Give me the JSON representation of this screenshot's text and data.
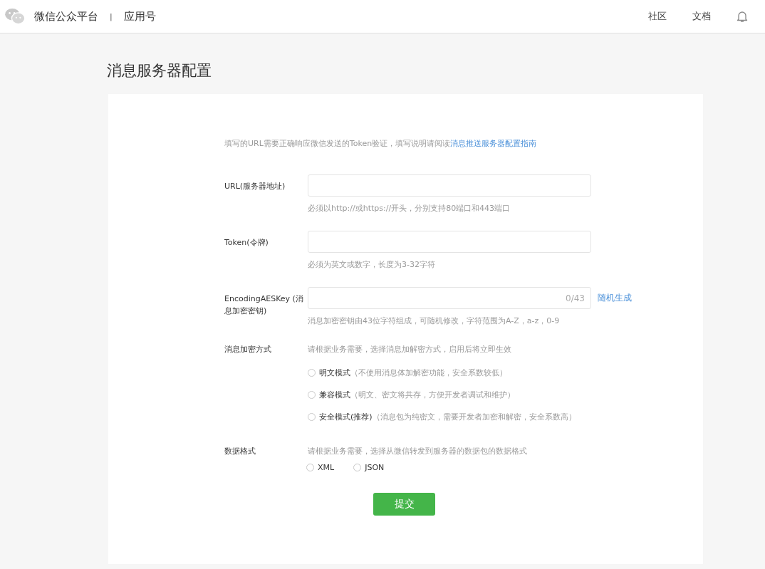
{
  "header": {
    "brand": "微信公众平台",
    "separator": "|",
    "product": "应用号",
    "nav": [
      {
        "label": "社区"
      },
      {
        "label": "文档"
      }
    ]
  },
  "page_title": "消息服务器配置",
  "notice": {
    "text": "填写的URL需要正确响应微信发送的Token验证，填写说明请阅读",
    "link": "消息推送服务器配置指南"
  },
  "fields": [
    {
      "label": "URL(服务器地址)",
      "hint": "必须以http://或https://开头，分别支持80端口和443端口"
    },
    {
      "label": "Token(令牌)",
      "hint": "必须为英文或数字，长度为3-32字符"
    },
    {
      "label": "EncodingAESKey (消息加密密钥)",
      "counter": "0/43",
      "action": "随机生成",
      "hint": "消息加密密钥由43位字符组成，可随机修改，字符范围为A-Z，a-z，0-9"
    }
  ],
  "encryption": {
    "label": "消息加密方式",
    "description": "请根据业务需要，选择消息加解密方式，启用后将立即生效",
    "options": [
      {
        "name": "明文模式",
        "note": "（不使用消息体加解密功能，安全系数较低）",
        "selected": false
      },
      {
        "name": "兼容模式",
        "note": "（明文、密文将共存，方便开发者调试和维护）",
        "selected": false
      },
      {
        "name": "安全模式(推荐)",
        "note": "（消息包为纯密文，需要开发者加密和解密，安全系数高）",
        "selected": false
      }
    ]
  },
  "data_format": {
    "label": "数据格式",
    "description": "请根据业务需要，选择从微信转发到服务器的数据包的数据格式",
    "options": [
      {
        "name": "XML",
        "selected": false
      },
      {
        "name": "JSON",
        "selected": false
      }
    ]
  },
  "submit": "提交"
}
